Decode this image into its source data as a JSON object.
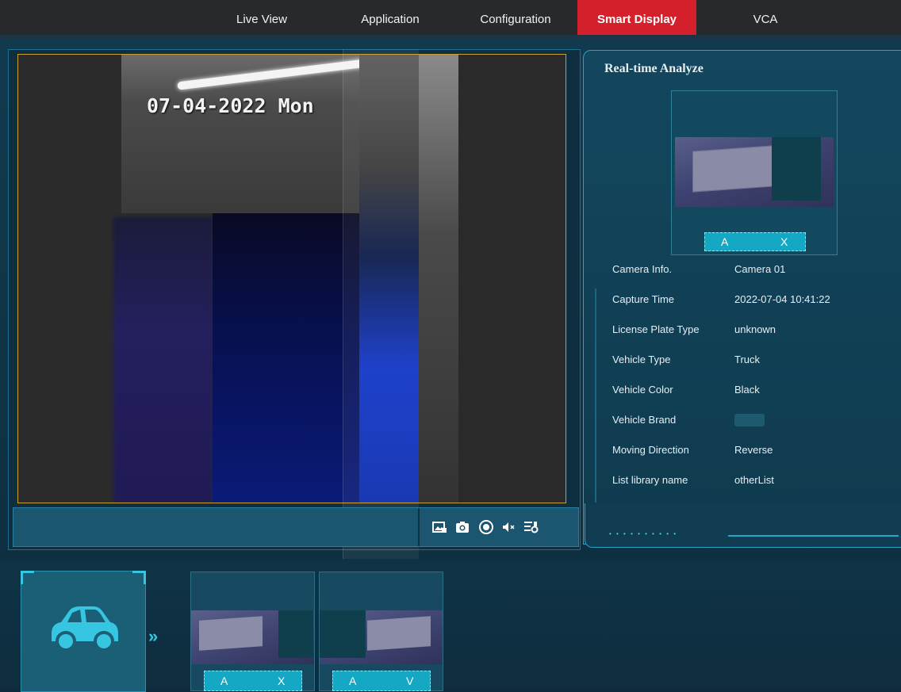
{
  "nav": {
    "items": [
      {
        "label": "Live View"
      },
      {
        "label": "Application"
      },
      {
        "label": "Configuration"
      },
      {
        "label": "Smart Display",
        "active": true
      },
      {
        "label": "VCA"
      }
    ],
    "active_color": "#d4202b"
  },
  "video": {
    "osd_text": "07-04-2022 Mon"
  },
  "toolbar": {
    "icons": [
      "capture-picture-icon",
      "snapshot-icon",
      "record-icon",
      "mute-icon",
      "settings-icon"
    ]
  },
  "analyze": {
    "title": "Real-time Analyze",
    "plate_left": "A",
    "plate_right": "X",
    "rows": [
      {
        "key": "Camera Info.",
        "value": "Camera 01"
      },
      {
        "key": "Capture Time",
        "value": "2022-07-04 10:41:22"
      },
      {
        "key": "License Plate Type",
        "value": "unknown"
      },
      {
        "key": "Vehicle Type",
        "value": "Truck"
      },
      {
        "key": "Vehicle Color",
        "value": "Black"
      },
      {
        "key": "Vehicle Brand",
        "value": ""
      },
      {
        "key": "Moving Direction",
        "value": "Reverse"
      },
      {
        "key": "List library name",
        "value": "otherList"
      }
    ]
  },
  "history": {
    "icon": "car-icon",
    "items": [
      {
        "plate_left": "A",
        "plate_right": "X"
      },
      {
        "plate_left": "A",
        "plate_right": "V"
      }
    ]
  },
  "colors": {
    "accent": "#37c6e2",
    "plate_label": "#15a8c4"
  }
}
